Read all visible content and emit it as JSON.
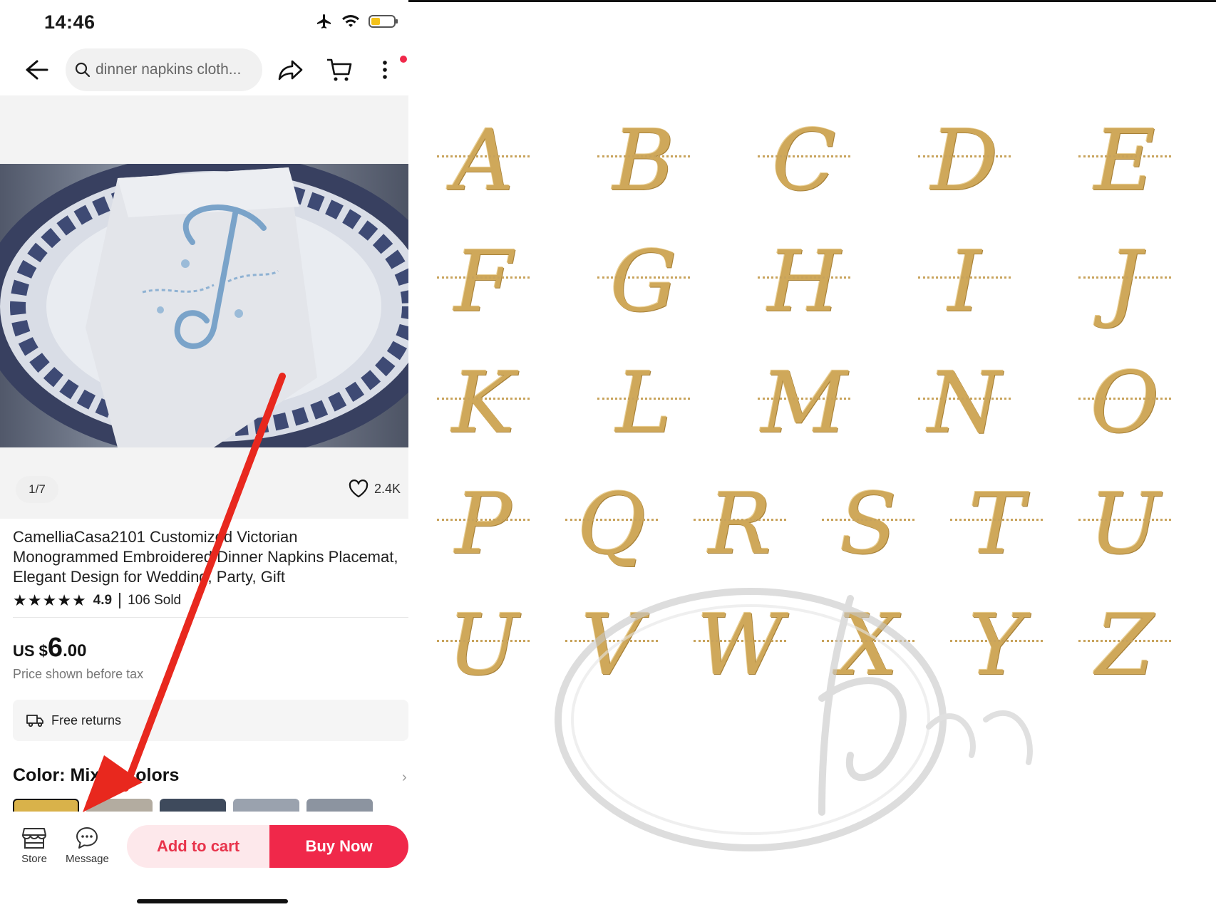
{
  "status": {
    "time": "14:46"
  },
  "topbar": {
    "search_text": "dinner napkins cloth..."
  },
  "gallery": {
    "counter": "1/7",
    "likes": "2.4K"
  },
  "product": {
    "title": "CamelliaCasa2101 Customized Victorian Monogrammed Embroidered Dinner Napkins Placemat, Elegant Design for Wedding, Party, Gift",
    "rating": "4.9",
    "sold": "106 Sold",
    "price_currency": "US $",
    "price_int": "6",
    "price_dec": ".00",
    "price_note": "Price shown before tax",
    "returns_label": "Free returns",
    "color_label": "Color: Mixed colors",
    "swatch_colors": [
      "#d9b24a",
      "#b3aca0",
      "#3e4a5c",
      "#9aa2ae",
      "#8c94a0"
    ]
  },
  "bottom_bar": {
    "store_label": "Store",
    "message_label": "Message",
    "add_to_cart": "Add to cart",
    "buy_now": "Buy Now"
  },
  "colors": {
    "accent": "#f0284a",
    "accent_light": "#fde8eb",
    "annotation_arrow": "#e8281e",
    "embroidery_gold": "#cfa85a",
    "napkin_embroidery": "#7aa3c9"
  },
  "monogram_sheet": {
    "rows": [
      [
        "A",
        "B",
        "C",
        "D",
        "E"
      ],
      [
        "F",
        "G",
        "H",
        "I",
        "J"
      ],
      [
        "K",
        "L",
        "M",
        "N",
        "O"
      ],
      [
        "P",
        "Q",
        "R",
        "S",
        "T",
        "U"
      ],
      [
        "U",
        "V",
        "W",
        "X",
        "Y",
        "Z"
      ]
    ]
  },
  "icons": [
    "back-arrow-icon",
    "search-icon",
    "share-icon",
    "cart-icon",
    "more-icon",
    "heart-icon",
    "truck-icon",
    "store-icon",
    "message-icon",
    "airplane-icon",
    "wifi-icon",
    "battery-icon"
  ]
}
